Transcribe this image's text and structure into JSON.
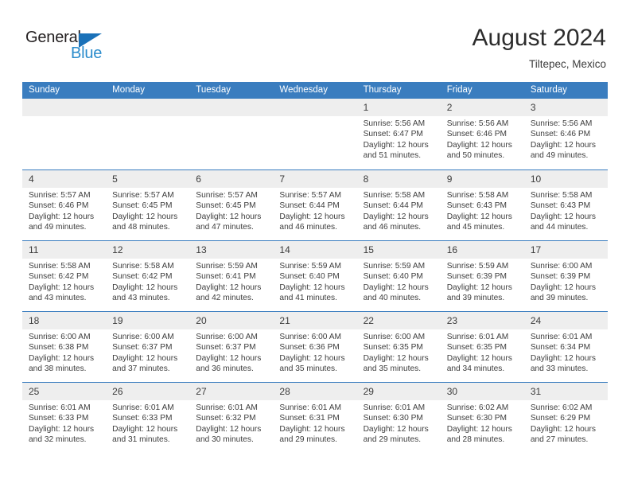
{
  "brand": {
    "name_top": "General",
    "name_bottom": "Blue",
    "accent_color": "#2b8ccc",
    "triangle_color": "#1a71b8"
  },
  "header": {
    "title": "August 2024",
    "location": "Tiltepec, Mexico"
  },
  "calendar": {
    "header_bg": "#3a7dbf",
    "daynum_bg": "#eeeeee",
    "weekdays": [
      "Sunday",
      "Monday",
      "Tuesday",
      "Wednesday",
      "Thursday",
      "Friday",
      "Saturday"
    ],
    "weeks": [
      [
        {
          "day": "",
          "sunrise": "",
          "sunset": "",
          "daylight_line1": "",
          "daylight_line2": ""
        },
        {
          "day": "",
          "sunrise": "",
          "sunset": "",
          "daylight_line1": "",
          "daylight_line2": ""
        },
        {
          "day": "",
          "sunrise": "",
          "sunset": "",
          "daylight_line1": "",
          "daylight_line2": ""
        },
        {
          "day": "",
          "sunrise": "",
          "sunset": "",
          "daylight_line1": "",
          "daylight_line2": ""
        },
        {
          "day": "1",
          "sunrise": "Sunrise: 5:56 AM",
          "sunset": "Sunset: 6:47 PM",
          "daylight_line1": "Daylight: 12 hours",
          "daylight_line2": "and 51 minutes."
        },
        {
          "day": "2",
          "sunrise": "Sunrise: 5:56 AM",
          "sunset": "Sunset: 6:46 PM",
          "daylight_line1": "Daylight: 12 hours",
          "daylight_line2": "and 50 minutes."
        },
        {
          "day": "3",
          "sunrise": "Sunrise: 5:56 AM",
          "sunset": "Sunset: 6:46 PM",
          "daylight_line1": "Daylight: 12 hours",
          "daylight_line2": "and 49 minutes."
        }
      ],
      [
        {
          "day": "4",
          "sunrise": "Sunrise: 5:57 AM",
          "sunset": "Sunset: 6:46 PM",
          "daylight_line1": "Daylight: 12 hours",
          "daylight_line2": "and 49 minutes."
        },
        {
          "day": "5",
          "sunrise": "Sunrise: 5:57 AM",
          "sunset": "Sunset: 6:45 PM",
          "daylight_line1": "Daylight: 12 hours",
          "daylight_line2": "and 48 minutes."
        },
        {
          "day": "6",
          "sunrise": "Sunrise: 5:57 AM",
          "sunset": "Sunset: 6:45 PM",
          "daylight_line1": "Daylight: 12 hours",
          "daylight_line2": "and 47 minutes."
        },
        {
          "day": "7",
          "sunrise": "Sunrise: 5:57 AM",
          "sunset": "Sunset: 6:44 PM",
          "daylight_line1": "Daylight: 12 hours",
          "daylight_line2": "and 46 minutes."
        },
        {
          "day": "8",
          "sunrise": "Sunrise: 5:58 AM",
          "sunset": "Sunset: 6:44 PM",
          "daylight_line1": "Daylight: 12 hours",
          "daylight_line2": "and 46 minutes."
        },
        {
          "day": "9",
          "sunrise": "Sunrise: 5:58 AM",
          "sunset": "Sunset: 6:43 PM",
          "daylight_line1": "Daylight: 12 hours",
          "daylight_line2": "and 45 minutes."
        },
        {
          "day": "10",
          "sunrise": "Sunrise: 5:58 AM",
          "sunset": "Sunset: 6:43 PM",
          "daylight_line1": "Daylight: 12 hours",
          "daylight_line2": "and 44 minutes."
        }
      ],
      [
        {
          "day": "11",
          "sunrise": "Sunrise: 5:58 AM",
          "sunset": "Sunset: 6:42 PM",
          "daylight_line1": "Daylight: 12 hours",
          "daylight_line2": "and 43 minutes."
        },
        {
          "day": "12",
          "sunrise": "Sunrise: 5:58 AM",
          "sunset": "Sunset: 6:42 PM",
          "daylight_line1": "Daylight: 12 hours",
          "daylight_line2": "and 43 minutes."
        },
        {
          "day": "13",
          "sunrise": "Sunrise: 5:59 AM",
          "sunset": "Sunset: 6:41 PM",
          "daylight_line1": "Daylight: 12 hours",
          "daylight_line2": "and 42 minutes."
        },
        {
          "day": "14",
          "sunrise": "Sunrise: 5:59 AM",
          "sunset": "Sunset: 6:40 PM",
          "daylight_line1": "Daylight: 12 hours",
          "daylight_line2": "and 41 minutes."
        },
        {
          "day": "15",
          "sunrise": "Sunrise: 5:59 AM",
          "sunset": "Sunset: 6:40 PM",
          "daylight_line1": "Daylight: 12 hours",
          "daylight_line2": "and 40 minutes."
        },
        {
          "day": "16",
          "sunrise": "Sunrise: 5:59 AM",
          "sunset": "Sunset: 6:39 PM",
          "daylight_line1": "Daylight: 12 hours",
          "daylight_line2": "and 39 minutes."
        },
        {
          "day": "17",
          "sunrise": "Sunrise: 6:00 AM",
          "sunset": "Sunset: 6:39 PM",
          "daylight_line1": "Daylight: 12 hours",
          "daylight_line2": "and 39 minutes."
        }
      ],
      [
        {
          "day": "18",
          "sunrise": "Sunrise: 6:00 AM",
          "sunset": "Sunset: 6:38 PM",
          "daylight_line1": "Daylight: 12 hours",
          "daylight_line2": "and 38 minutes."
        },
        {
          "day": "19",
          "sunrise": "Sunrise: 6:00 AM",
          "sunset": "Sunset: 6:37 PM",
          "daylight_line1": "Daylight: 12 hours",
          "daylight_line2": "and 37 minutes."
        },
        {
          "day": "20",
          "sunrise": "Sunrise: 6:00 AM",
          "sunset": "Sunset: 6:37 PM",
          "daylight_line1": "Daylight: 12 hours",
          "daylight_line2": "and 36 minutes."
        },
        {
          "day": "21",
          "sunrise": "Sunrise: 6:00 AM",
          "sunset": "Sunset: 6:36 PM",
          "daylight_line1": "Daylight: 12 hours",
          "daylight_line2": "and 35 minutes."
        },
        {
          "day": "22",
          "sunrise": "Sunrise: 6:00 AM",
          "sunset": "Sunset: 6:35 PM",
          "daylight_line1": "Daylight: 12 hours",
          "daylight_line2": "and 35 minutes."
        },
        {
          "day": "23",
          "sunrise": "Sunrise: 6:01 AM",
          "sunset": "Sunset: 6:35 PM",
          "daylight_line1": "Daylight: 12 hours",
          "daylight_line2": "and 34 minutes."
        },
        {
          "day": "24",
          "sunrise": "Sunrise: 6:01 AM",
          "sunset": "Sunset: 6:34 PM",
          "daylight_line1": "Daylight: 12 hours",
          "daylight_line2": "and 33 minutes."
        }
      ],
      [
        {
          "day": "25",
          "sunrise": "Sunrise: 6:01 AM",
          "sunset": "Sunset: 6:33 PM",
          "daylight_line1": "Daylight: 12 hours",
          "daylight_line2": "and 32 minutes."
        },
        {
          "day": "26",
          "sunrise": "Sunrise: 6:01 AM",
          "sunset": "Sunset: 6:33 PM",
          "daylight_line1": "Daylight: 12 hours",
          "daylight_line2": "and 31 minutes."
        },
        {
          "day": "27",
          "sunrise": "Sunrise: 6:01 AM",
          "sunset": "Sunset: 6:32 PM",
          "daylight_line1": "Daylight: 12 hours",
          "daylight_line2": "and 30 minutes."
        },
        {
          "day": "28",
          "sunrise": "Sunrise: 6:01 AM",
          "sunset": "Sunset: 6:31 PM",
          "daylight_line1": "Daylight: 12 hours",
          "daylight_line2": "and 29 minutes."
        },
        {
          "day": "29",
          "sunrise": "Sunrise: 6:01 AM",
          "sunset": "Sunset: 6:30 PM",
          "daylight_line1": "Daylight: 12 hours",
          "daylight_line2": "and 29 minutes."
        },
        {
          "day": "30",
          "sunrise": "Sunrise: 6:02 AM",
          "sunset": "Sunset: 6:30 PM",
          "daylight_line1": "Daylight: 12 hours",
          "daylight_line2": "and 28 minutes."
        },
        {
          "day": "31",
          "sunrise": "Sunrise: 6:02 AM",
          "sunset": "Sunset: 6:29 PM",
          "daylight_line1": "Daylight: 12 hours",
          "daylight_line2": "and 27 minutes."
        }
      ]
    ]
  }
}
